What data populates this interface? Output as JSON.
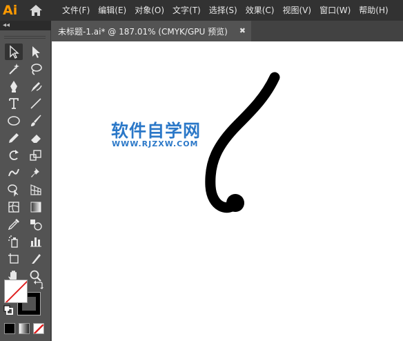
{
  "app": {
    "logo": "Ai",
    "logo_color": "#ff9a00"
  },
  "menu": [
    {
      "label": "文件(F)"
    },
    {
      "label": "编辑(E)"
    },
    {
      "label": "对象(O)"
    },
    {
      "label": "文字(T)"
    },
    {
      "label": "选择(S)"
    },
    {
      "label": "效果(C)"
    },
    {
      "label": "视图(V)"
    },
    {
      "label": "窗口(W)"
    },
    {
      "label": "帮助(H)"
    }
  ],
  "panel": {
    "collapse": "◂◂"
  },
  "document_tab": {
    "label": "未标题-1.ai* @ 187.01% (CMYK/GPU 预览)",
    "close": "✖"
  },
  "canvas": {
    "watermark_title": "软件自学网",
    "watermark_url": "WWW.RJZXW.COM",
    "watermark_color": "#2b78c8",
    "background": "#ffffff"
  },
  "tools": [
    {
      "name": "selection-tool",
      "icon": "selection-arrow-icon",
      "selected": true
    },
    {
      "name": "direct-selection-tool",
      "icon": "direct-selection-arrow-icon"
    },
    {
      "name": "magic-wand-tool",
      "icon": "magic-wand-icon"
    },
    {
      "name": "lasso-tool",
      "icon": "lasso-icon"
    },
    {
      "name": "pen-tool",
      "icon": "pen-icon"
    },
    {
      "name": "curvature-tool",
      "icon": "curvature-pen-icon"
    },
    {
      "name": "type-tool",
      "icon": "type-icon"
    },
    {
      "name": "line-segment-tool",
      "icon": "line-icon"
    },
    {
      "name": "ellipse-tool",
      "icon": "ellipse-icon"
    },
    {
      "name": "paintbrush-tool",
      "icon": "brush-icon"
    },
    {
      "name": "pencil-tool",
      "icon": "pencil-icon"
    },
    {
      "name": "eraser-tool",
      "icon": "eraser-icon"
    },
    {
      "name": "rotate-tool",
      "icon": "rotate-icon"
    },
    {
      "name": "scale-tool",
      "icon": "scale-icon"
    },
    {
      "name": "warp-tool",
      "icon": "warp-icon"
    },
    {
      "name": "puppet-warp-tool",
      "icon": "pin-icon"
    },
    {
      "name": "shape-builder-tool",
      "icon": "shape-builder-icon"
    },
    {
      "name": "perspective-grid-tool",
      "icon": "perspective-grid-icon"
    },
    {
      "name": "mesh-tool",
      "icon": "mesh-icon"
    },
    {
      "name": "gradient-tool",
      "icon": "gradient-icon"
    },
    {
      "name": "eyedropper-tool",
      "icon": "eyedropper-icon"
    },
    {
      "name": "blend-tool",
      "icon": "blend-icon"
    },
    {
      "name": "symbol-sprayer-tool",
      "icon": "spray-icon"
    },
    {
      "name": "column-graph-tool",
      "icon": "bar-chart-icon"
    },
    {
      "name": "artboard-tool",
      "icon": "artboard-icon"
    },
    {
      "name": "slice-tool",
      "icon": "knife-icon"
    },
    {
      "name": "hand-tool",
      "icon": "hand-icon"
    },
    {
      "name": "zoom-tool",
      "icon": "zoom-icon"
    }
  ]
}
